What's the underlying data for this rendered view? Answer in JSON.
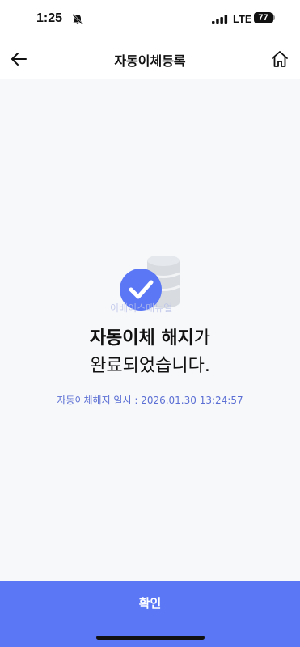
{
  "status_bar": {
    "time": "1:25",
    "network": "LTE",
    "battery": "77",
    "icons": [
      "bell-slash-icon",
      "signal-icon",
      "battery-icon"
    ]
  },
  "header": {
    "title": "자동이체등록",
    "back_icon": "arrow-left-icon",
    "home_icon": "home-icon"
  },
  "result": {
    "illustration": "check-with-database-icon",
    "watermark": "이베이스매뉴얼",
    "title_bold": "자동이체 해지",
    "title_suffix": "가",
    "title_line2": "완료되었습니다.",
    "date_text": "자동이체해지 일시 : 2026.01.30 13:24:57"
  },
  "footer": {
    "confirm_label": "확인"
  },
  "colors": {
    "accent": "#5b77f5",
    "date_text": "#5b6fd4",
    "background": "#f7f8fa"
  }
}
